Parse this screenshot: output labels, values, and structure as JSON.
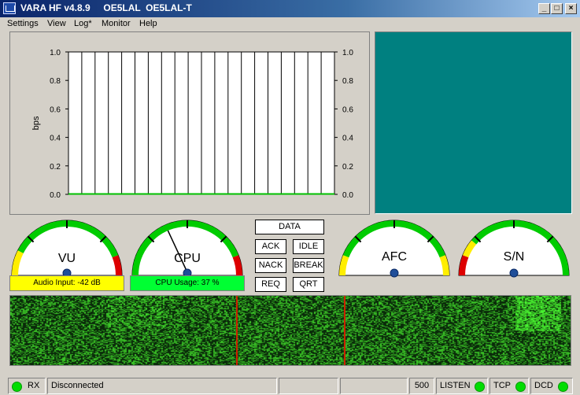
{
  "window": {
    "title": "VARA HF v4.8.9     OE5LAL  OE5LAL-T",
    "minimize": "_",
    "maximize": "□",
    "close": "×"
  },
  "menu": [
    "Settings",
    "View",
    "Log*",
    "Monitor",
    "Help"
  ],
  "chart_data": {
    "type": "line",
    "ylabel": "bps",
    "yticks": [
      "0.0",
      "0.2",
      "0.4",
      "0.6",
      "0.8",
      "1.0"
    ],
    "ylim": [
      0,
      1
    ],
    "right_axis_ticks": [
      "0.0",
      "0.2",
      "0.4",
      "0.6",
      "0.8",
      "1.0"
    ],
    "grid": true,
    "vertical_gridlines": 20,
    "series": [
      {
        "values": [
          0,
          0,
          0,
          0,
          0,
          0,
          0,
          0,
          0,
          0,
          0,
          0,
          0,
          0,
          0,
          0,
          0,
          0,
          0,
          0,
          0
        ],
        "color": "#00c000"
      }
    ]
  },
  "gauges": {
    "vu": {
      "label": "VU",
      "readout": "Audio Input: -42 dB",
      "readout_color": "#ffff00"
    },
    "cpu": {
      "label": "CPU",
      "readout": "CPU Usage: 37 %",
      "readout_color": "#00ff33",
      "level": 0.37
    },
    "afc": {
      "label": "AFC"
    },
    "sn": {
      "label": "S/N"
    }
  },
  "controls": {
    "data": "DATA",
    "ack": "ACK",
    "idle": "IDLE",
    "nack": "NACK",
    "break": "BREAK",
    "req": "REQ",
    "qrt": "QRT"
  },
  "status": {
    "rx": "RX",
    "state": "Disconnected",
    "bandwidth": "500",
    "listen": "LISTEN",
    "tcp": "TCP",
    "dcd": "DCD",
    "led_color": "#00dd00"
  },
  "colors": {
    "teal_panel": "#008080",
    "waterfall_bg": "#0a2a0a",
    "waterfall_marker": "#cc2200"
  }
}
